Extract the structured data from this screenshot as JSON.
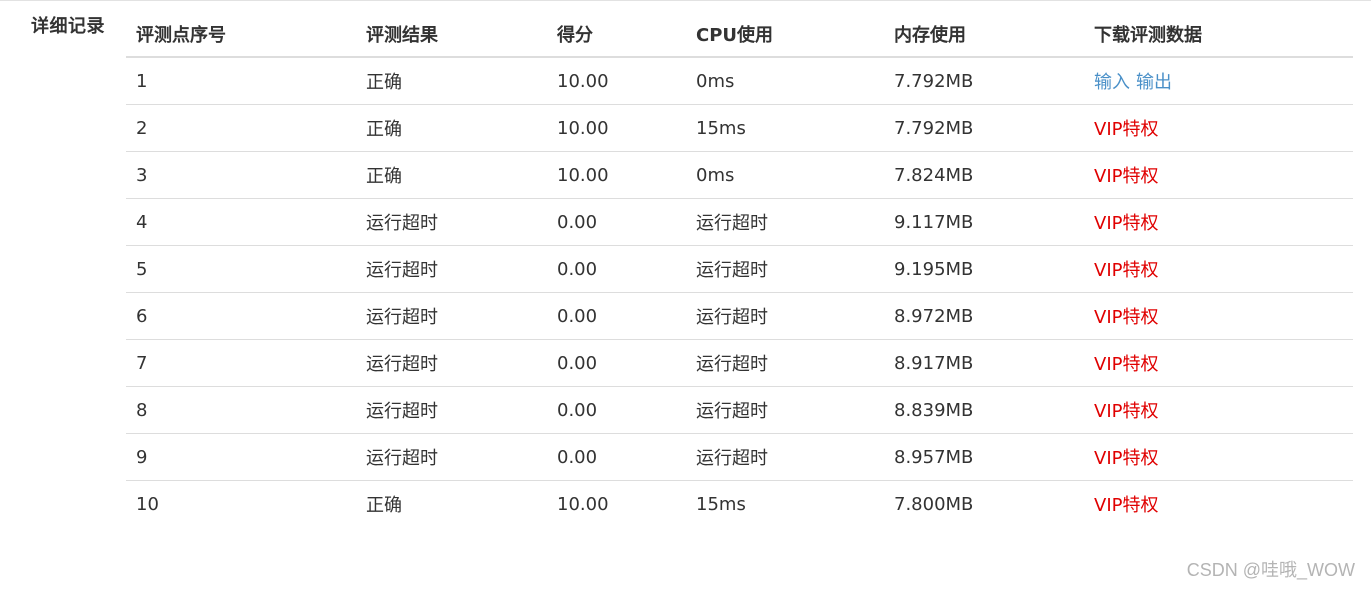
{
  "section": {
    "label": "详细记录"
  },
  "table": {
    "headers": [
      "评测点序号",
      "评测结果",
      "得分",
      "CPU使用",
      "内存使用",
      "下载评测数据"
    ],
    "rows": [
      {
        "id": "1",
        "result": "正确",
        "score": "10.00",
        "cpu": "0ms",
        "mem": "7.792MB",
        "download": {
          "input": "输入",
          "output": "输出"
        }
      },
      {
        "id": "2",
        "result": "正确",
        "score": "10.00",
        "cpu": "15ms",
        "mem": "7.792MB",
        "download": {
          "vip": "VIP特权"
        }
      },
      {
        "id": "3",
        "result": "正确",
        "score": "10.00",
        "cpu": "0ms",
        "mem": "7.824MB",
        "download": {
          "vip": "VIP特权"
        }
      },
      {
        "id": "4",
        "result": "运行超时",
        "score": "0.00",
        "cpu": "运行超时",
        "mem": "9.117MB",
        "download": {
          "vip": "VIP特权"
        }
      },
      {
        "id": "5",
        "result": "运行超时",
        "score": "0.00",
        "cpu": "运行超时",
        "mem": "9.195MB",
        "download": {
          "vip": "VIP特权"
        }
      },
      {
        "id": "6",
        "result": "运行超时",
        "score": "0.00",
        "cpu": "运行超时",
        "mem": "8.972MB",
        "download": {
          "vip": "VIP特权"
        }
      },
      {
        "id": "7",
        "result": "运行超时",
        "score": "0.00",
        "cpu": "运行超时",
        "mem": "8.917MB",
        "download": {
          "vip": "VIP特权"
        }
      },
      {
        "id": "8",
        "result": "运行超时",
        "score": "0.00",
        "cpu": "运行超时",
        "mem": "8.839MB",
        "download": {
          "vip": "VIP特权"
        }
      },
      {
        "id": "9",
        "result": "运行超时",
        "score": "0.00",
        "cpu": "运行超时",
        "mem": "8.957MB",
        "download": {
          "vip": "VIP特权"
        }
      },
      {
        "id": "10",
        "result": "正确",
        "score": "10.00",
        "cpu": "15ms",
        "mem": "7.800MB",
        "download": {
          "vip": "VIP特权"
        }
      }
    ]
  },
  "watermark": "CSDN @哇哦_WOW",
  "colors": {
    "link": "#4a90c8",
    "vip": "#e00000",
    "text": "#333333",
    "border": "#dddddd"
  }
}
